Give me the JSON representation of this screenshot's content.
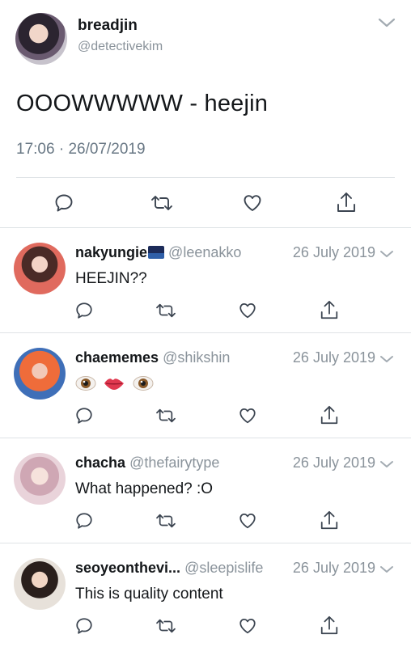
{
  "main_tweet": {
    "display_name": "breadjin",
    "handle": "@detectivekim",
    "text": "OOOWWWWW - heejin",
    "time": "17:06",
    "date": "26/07/2019",
    "icons": {
      "menu": "chevron-down-icon",
      "reply": "reply-icon",
      "retweet": "retweet-icon",
      "like": "heart-icon",
      "share": "share-icon"
    }
  },
  "replies": [
    {
      "display_name": "nakyungie",
      "name_badge": "city-night-emoji",
      "handle": "@leenakko",
      "date": "26 July 2019",
      "text": "HEEJIN??"
    },
    {
      "display_name": "chaememes",
      "handle": "@shikshin",
      "date": "26 July 2019",
      "text": "",
      "emoji": [
        "eye-emoji",
        "lips-emoji",
        "eye-emoji"
      ]
    },
    {
      "display_name": "chacha",
      "handle": "@thefairytype",
      "date": "26 July 2019",
      "text": "What happened? :O"
    },
    {
      "display_name": "seoyeonthevi...",
      "handle": "@sleepislife",
      "date": "26 July 2019",
      "text": "This is quality content"
    }
  ],
  "colors": {
    "text": "#14171a",
    "muted": "#8a939b",
    "divider": "#dfe3e6",
    "icon": "#657786"
  }
}
